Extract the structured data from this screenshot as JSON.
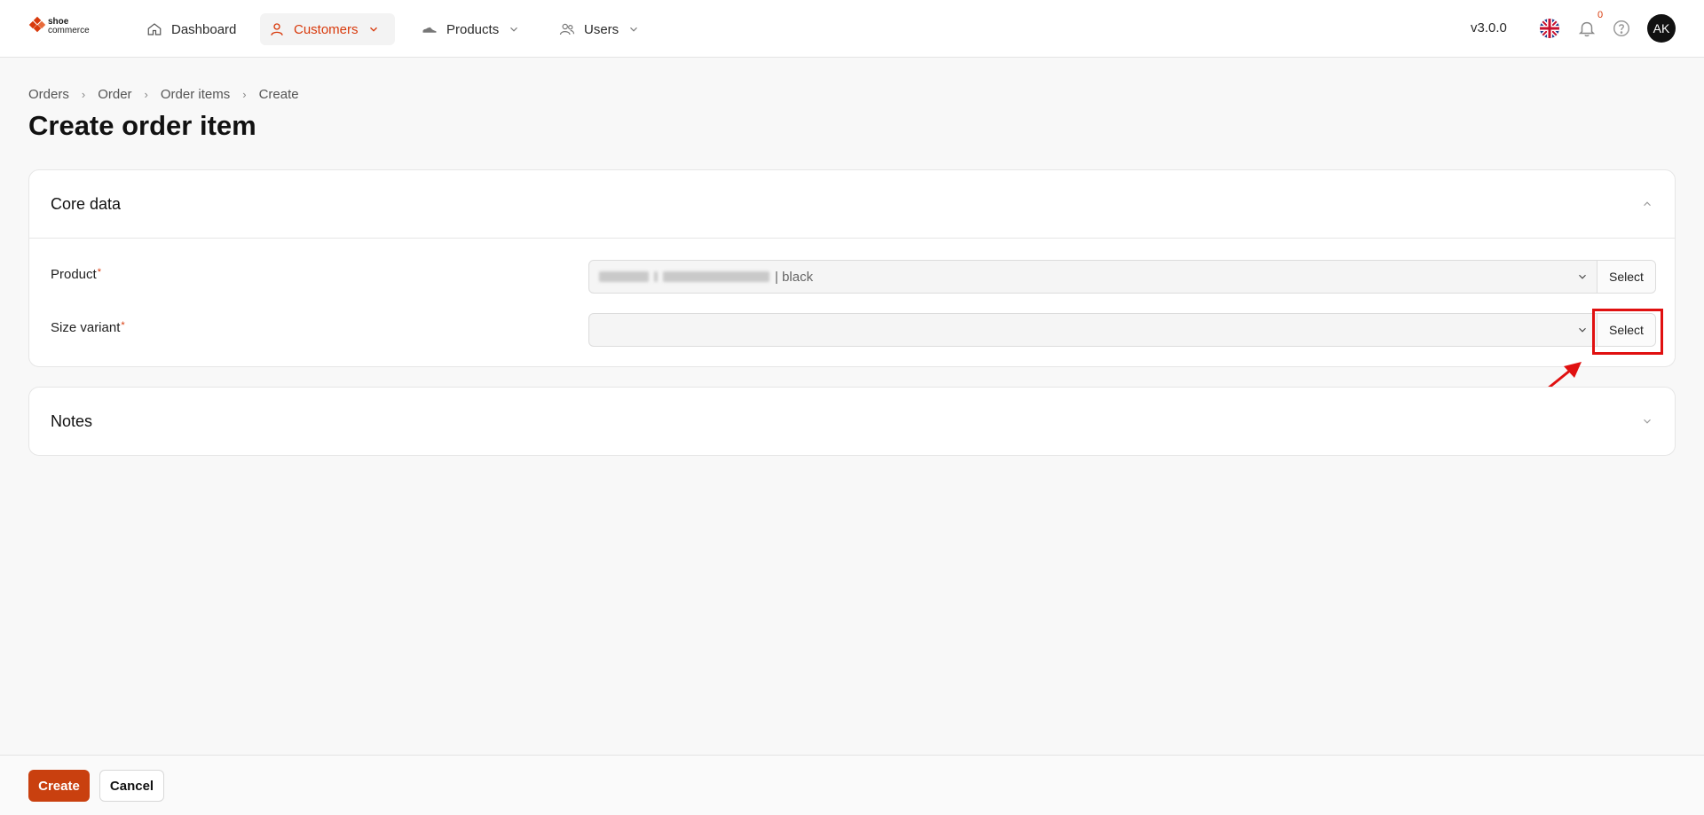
{
  "brand": {
    "logo_top": "shoe",
    "logo_bottom": "commerce"
  },
  "nav": {
    "items": [
      {
        "label": "Dashboard",
        "icon": "home-icon",
        "active": false,
        "has_dropdown": false
      },
      {
        "label": "Customers",
        "icon": "user-icon",
        "active": true,
        "has_dropdown": true
      },
      {
        "label": "Products",
        "icon": "shoe-icon",
        "active": false,
        "has_dropdown": true
      },
      {
        "label": "Users",
        "icon": "users-icon",
        "active": false,
        "has_dropdown": true
      }
    ],
    "version": "v3.0.0",
    "notifications_count": "0",
    "avatar_initials": "AK"
  },
  "breadcrumb": [
    "Orders",
    "Order",
    "Order items",
    "Create"
  ],
  "page_title": "Create order item",
  "sections": {
    "core": {
      "title": "Core data",
      "fields": {
        "product": {
          "label": "Product",
          "required_mark": "*",
          "value_suffix": "| black",
          "button": "Select"
        },
        "size_variant": {
          "label": "Size variant",
          "required_mark": "*",
          "value": "",
          "button": "Select"
        }
      }
    },
    "notes": {
      "title": "Notes"
    }
  },
  "footer": {
    "create_label": "Create",
    "cancel_label": "Cancel"
  },
  "colors": {
    "accent": "#d8390b",
    "annotation": "#e01010",
    "avatar_bg": "#111111"
  }
}
